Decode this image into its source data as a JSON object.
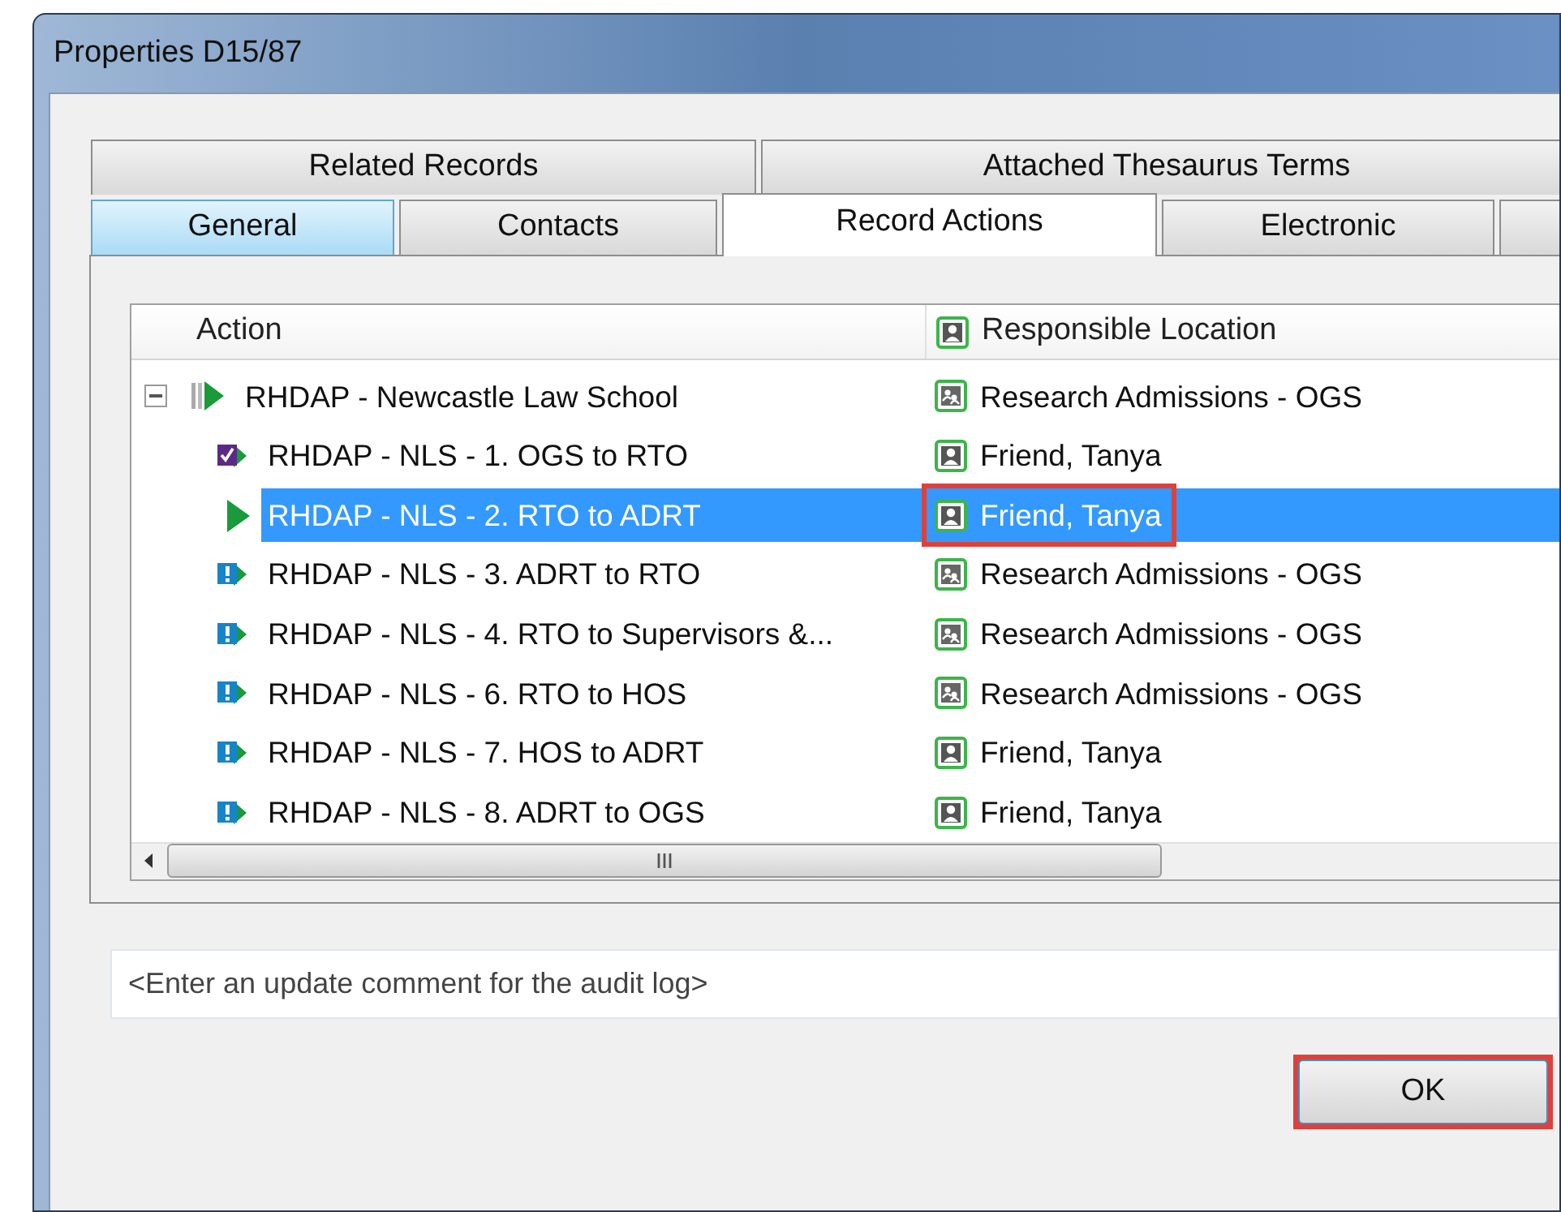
{
  "window": {
    "title": "Properties D15/87"
  },
  "tab_rows": [
    [
      {
        "label": "Related Records",
        "selected": false,
        "hover": false
      },
      {
        "label": "Attached Thesaurus Terms",
        "selected": false,
        "hover": false
      }
    ],
    [
      {
        "label": "General",
        "selected": false,
        "hover": true
      },
      {
        "label": "Contacts",
        "selected": false,
        "hover": false
      },
      {
        "label": "Record Actions",
        "selected": true,
        "hover": false
      },
      {
        "label": "Electronic",
        "selected": false,
        "hover": false
      },
      {
        "selected": false,
        "hover": false
      }
    ]
  ],
  "table": {
    "columns": [
      "Action",
      "Responsible Location"
    ],
    "rows": [
      {
        "kind": "group",
        "action": "RHDAP - Newcastle Law School",
        "location": {
          "kind": "group",
          "text": "Research Admissions - OGS"
        },
        "selected": false,
        "highlighted": false,
        "expanded": true,
        "children": [
          {
            "kind": "done",
            "action": "RHDAP - NLS - 1. OGS to RTO",
            "location": {
              "kind": "person",
              "text": "Friend, Tanya"
            },
            "selected": false,
            "highlighted": false
          },
          {
            "kind": "current",
            "action": "RHDAP - NLS - 2. RTO to ADRT",
            "location": {
              "kind": "person",
              "text": "Friend, Tanya"
            },
            "selected": true,
            "highlighted": true
          },
          {
            "kind": "pending",
            "action": "RHDAP - NLS - 3. ADRT to RTO",
            "location": {
              "kind": "group",
              "text": "Research Admissions - OGS"
            },
            "selected": false,
            "highlighted": false
          },
          {
            "kind": "pending",
            "action": "RHDAP - NLS - 4. RTO to Supervisors &...",
            "location": {
              "kind": "group",
              "text": "Research Admissions - OGS"
            },
            "selected": false,
            "highlighted": false
          },
          {
            "kind": "pending",
            "action": "RHDAP - NLS - 6. RTO to HOS",
            "location": {
              "kind": "group",
              "text": "Research Admissions - OGS"
            },
            "selected": false,
            "highlighted": false
          },
          {
            "kind": "pending",
            "action": "RHDAP - NLS - 7. HOS to ADRT",
            "location": {
              "kind": "person",
              "text": "Friend, Tanya"
            },
            "selected": false,
            "highlighted": false
          },
          {
            "kind": "pending",
            "action": "RHDAP - NLS - 8. ADRT to OGS",
            "location": {
              "kind": "person",
              "text": "Friend, Tanya"
            },
            "selected": false,
            "highlighted": false
          }
        ]
      }
    ]
  },
  "comment": {
    "placeholder": "<Enter an update comment for the audit log>"
  },
  "ok_button": {
    "label": "OK",
    "highlighted": true
  }
}
